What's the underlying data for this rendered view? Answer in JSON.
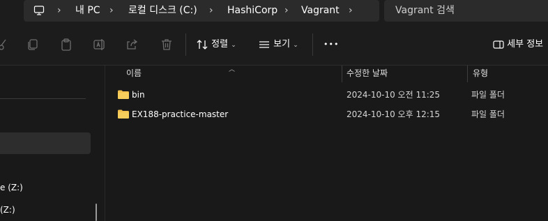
{
  "address": {
    "crumbs": [
      "내 PC",
      "로컬 디스크 (C:)",
      "HashiCorp",
      "Vagrant"
    ],
    "search_placeholder": "Vagrant 검색"
  },
  "toolbar": {
    "sort_label": "정렬",
    "view_label": "보기",
    "more_label": "•••",
    "details_label": "세부 정보"
  },
  "nav": {
    "items": [
      "e (Z:)",
      "(Z:)"
    ]
  },
  "columns": {
    "name": "이름",
    "modified": "수정한 날짜",
    "type": "유형"
  },
  "files": [
    {
      "name": "bin",
      "modified": "2024-10-10 오전 11:25",
      "type": "파일 폴더"
    },
    {
      "name": "EX188-practice-master",
      "modified": "2024-10-10 오후 12:15",
      "type": "파일 폴더"
    }
  ],
  "colors": {
    "background": "#191919",
    "folder": "#f2c14e"
  }
}
